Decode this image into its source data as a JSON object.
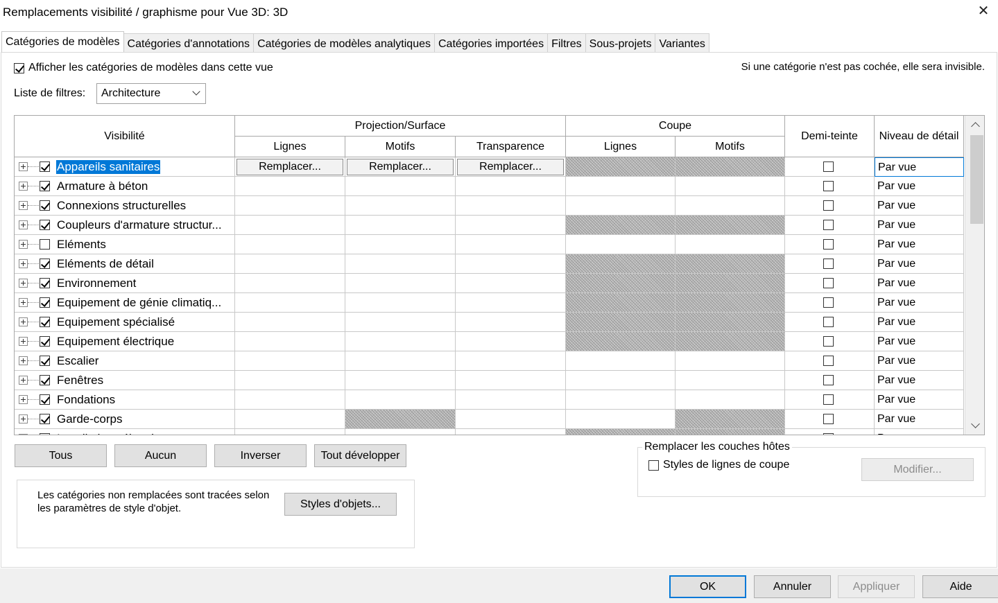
{
  "window": {
    "title": "Remplacements visibilité / graphisme pour Vue 3D: 3D",
    "close_glyph": "✕"
  },
  "tabs": [
    {
      "label": "Catégories de modèles",
      "active": true
    },
    {
      "label": "Catégories d'annotations"
    },
    {
      "label": "Catégories de modèles analytiques"
    },
    {
      "label": "Catégories importées"
    },
    {
      "label": "Filtres"
    },
    {
      "label": "Sous-projets"
    },
    {
      "label": "Variantes"
    }
  ],
  "options": {
    "show_label": "Afficher les catégories de modèles dans cette vue",
    "show_checked": true,
    "hint": "Si une catégorie n'est pas cochée, elle sera invisible.",
    "filter_label": "Liste de filtres:",
    "filter_value": "Architecture"
  },
  "grid": {
    "headers": {
      "visibility": "Visibilité",
      "projection": "Projection/Surface",
      "cut": "Coupe",
      "halftone": "Demi-teinte",
      "detail_level": "Niveau de détail",
      "lines": "Lignes",
      "patterns": "Motifs",
      "transparency": "Transparence",
      "cut_lines": "Lignes",
      "cut_patterns": "Motifs"
    },
    "override_label": "Remplacer...",
    "rows": [
      {
        "name": "Appareils sanitaires",
        "visible": true,
        "halftone": false,
        "level": "Par vue",
        "selected": true
      },
      {
        "name": "Armature à béton",
        "visible": true,
        "halftone": false,
        "level": "Par vue"
      },
      {
        "name": "Connexions structurelles",
        "visible": true,
        "halftone": false,
        "level": "Par vue"
      },
      {
        "name": "Coupleurs d'armature structur...",
        "visible": true,
        "halftone": false,
        "level": "Par vue"
      },
      {
        "name": "Eléments",
        "visible": false,
        "halftone": false,
        "level": "Par vue"
      },
      {
        "name": "Eléments de détail",
        "visible": true,
        "halftone": false,
        "level": "Par vue"
      },
      {
        "name": "Environnement",
        "visible": true,
        "halftone": false,
        "level": "Par vue"
      },
      {
        "name": "Equipement de génie climatiq...",
        "visible": true,
        "halftone": false,
        "level": "Par vue"
      },
      {
        "name": "Equipement spécialisé",
        "visible": true,
        "halftone": false,
        "level": "Par vue"
      },
      {
        "name": "Equipement électrique",
        "visible": true,
        "halftone": false,
        "level": "Par vue"
      },
      {
        "name": "Escalier",
        "visible": true,
        "halftone": false,
        "level": "Par vue"
      },
      {
        "name": "Fenêtres",
        "visible": true,
        "halftone": false,
        "level": "Par vue"
      },
      {
        "name": "Fondations",
        "visible": true,
        "halftone": false,
        "level": "Par vue"
      },
      {
        "name": "Garde-corps",
        "visible": true,
        "halftone": false,
        "level": "Par vue"
      },
      {
        "name": "Installations électriques",
        "visible": true,
        "halftone": false,
        "level": "Par vue"
      }
    ]
  },
  "buttons": {
    "all": "Tous",
    "none": "Aucun",
    "invert": "Inverser",
    "expand_all": "Tout développer",
    "object_styles": "Styles d'objets...",
    "modify": "Modifier...",
    "ok": "OK",
    "cancel": "Annuler",
    "apply": "Appliquer",
    "help": "Aide"
  },
  "info": {
    "text": "Les catégories non remplacées sont tracées selon les paramètres de style d'objet."
  },
  "host_layers": {
    "legend": "Remplacer les couches hôtes",
    "option_label": "Styles de lignes de coupe",
    "option_checked": false
  }
}
